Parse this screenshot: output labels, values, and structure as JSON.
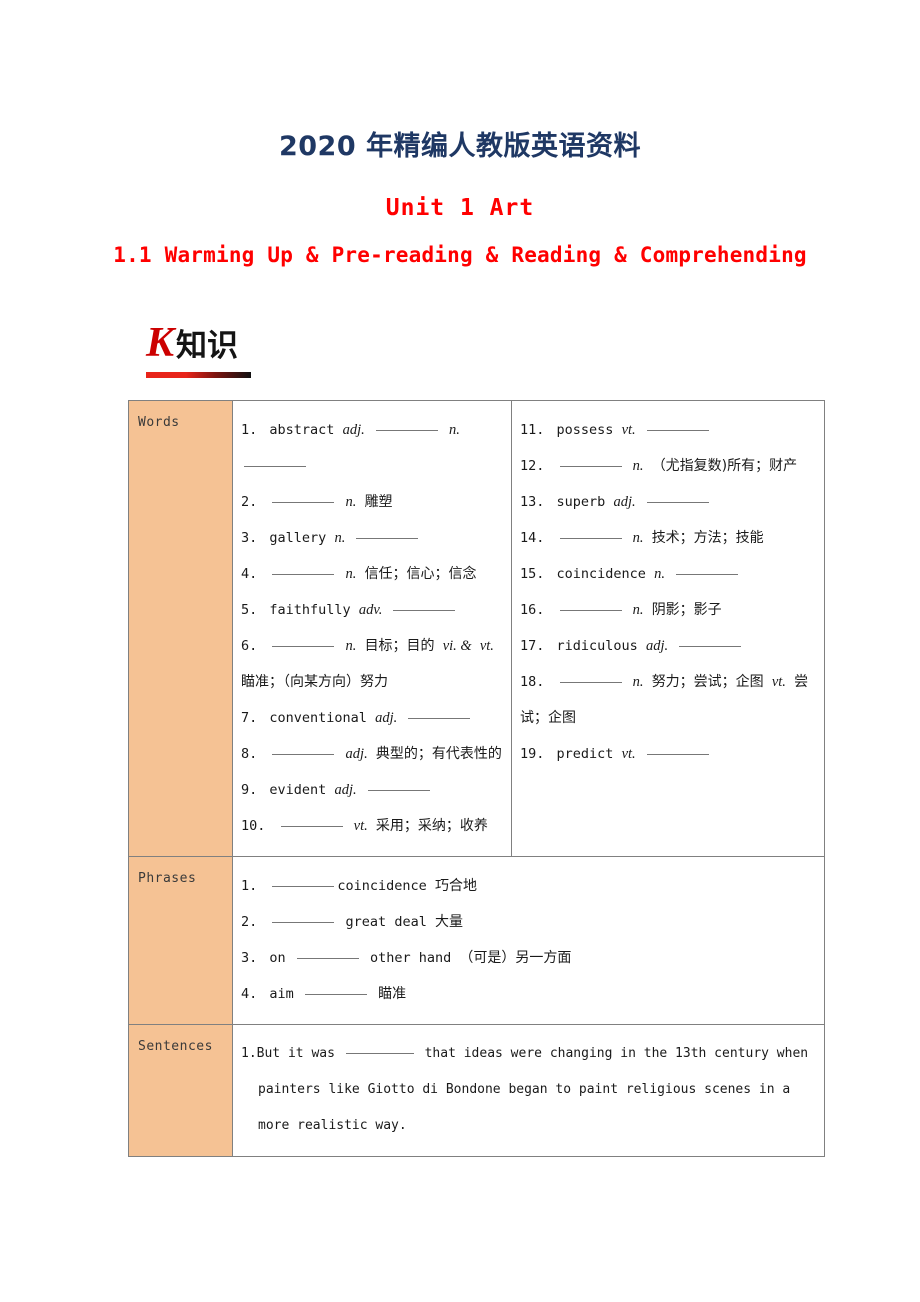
{
  "header": {
    "doc_title": "2020 年精编人教版英语资料",
    "unit_title": "Unit 1  Art",
    "sub_title": "1.1  Warming Up & Pre-reading & Reading & Comprehending"
  },
  "logo": {
    "letter": "K",
    "cn_text": "知识",
    "letter_color": "#CC0000",
    "rule_from": "#E8241A",
    "rule_to": "#101010"
  },
  "table": {
    "header_bg": "#F5C294",
    "border_color": "#808080",
    "rows": {
      "words_label": "Words",
      "phrases_label": "Phrases",
      "sentences_label": "Sentences"
    }
  },
  "words_left": [
    {
      "num": "1.",
      "pre": "abstract",
      "pos1": "adj.",
      "blank1": true,
      "pos2": "n.",
      "blank2": true,
      "cn": ""
    },
    {
      "num": "2.",
      "pre": "",
      "pos1": "",
      "blank_lead": true,
      "pos2": "n.",
      "cn": "雕塑"
    },
    {
      "num": "3.",
      "pre": "gallery",
      "pos1": "n.",
      "blank1": true,
      "cn": ""
    },
    {
      "num": "4.",
      "pre": "",
      "blank_lead": true,
      "pos2": "n.",
      "cn": "信任；信心；信念"
    },
    {
      "num": "5.",
      "pre": "faithfully",
      "pos1": "adv.",
      "blank1": true,
      "cn": ""
    },
    {
      "num": "6.",
      "pre": "",
      "blank_lead": true,
      "pos2": "n.",
      "cn": "目标；目的",
      "pos3": "vi. &",
      "pos4": "vt.",
      "cn2": "瞄准；（向某方向）努力"
    },
    {
      "num": "7.",
      "pre": "conventional",
      "pos1": "adj.",
      "blank1": true,
      "cn": ""
    },
    {
      "num": "8.",
      "pre": "",
      "blank_lead": true,
      "pos2": "adj.",
      "cn": "典型的；有代表性的"
    },
    {
      "num": "9.",
      "pre": "evident",
      "pos1": "adj.",
      "blank1": true,
      "cn": ""
    },
    {
      "num": "10.",
      "pre": "",
      "blank_lead": true,
      "pos2": "vt.",
      "cn": "采用；采纳；收养"
    }
  ],
  "words_right": [
    {
      "num": "11.",
      "pre": "possess",
      "pos1": "vt.",
      "blank1": true,
      "cn": ""
    },
    {
      "num": "12.",
      "pre": "",
      "blank_lead": true,
      "pos2": "n.",
      "cn": "（尤指复数)所有；财产"
    },
    {
      "num": "13.",
      "pre": "superb",
      "pos1": "adj.",
      "blank1": true,
      "cn": ""
    },
    {
      "num": "14.",
      "pre": "",
      "blank_lead": true,
      "pos2": "n.",
      "cn": "技术；方法；技能"
    },
    {
      "num": "15.",
      "pre": "coincidence",
      "pos1": "n.",
      "blank1": true,
      "cn": ""
    },
    {
      "num": "16.",
      "pre": "",
      "blank_lead": true,
      "pos2": "n.",
      "cn": "阴影；影子"
    },
    {
      "num": "17.",
      "pre": "ridiculous",
      "pos1": "adj.",
      "blank1": true,
      "cn": ""
    },
    {
      "num": "18.",
      "pre": "",
      "blank_lead": true,
      "pos2": "n.",
      "cn": "努力；尝试；企图",
      "pos4": "vt.",
      "cn2": "尝试；企图"
    },
    {
      "num": "19.",
      "pre": "predict",
      "pos1": "vt.",
      "blank1": true,
      "cn": ""
    }
  ],
  "phrases": [
    {
      "num": "1.",
      "blank_lead": true,
      "tail": "coincidence",
      "cn": "巧合地"
    },
    {
      "num": "2.",
      "blank_lead": true,
      "tail": "great deal",
      "cn": "大量"
    },
    {
      "num": "3.",
      "pre": "on",
      "blank_mid": true,
      "tail": "other hand",
      "cn": "（可是）另一方面"
    },
    {
      "num": "4.",
      "pre": "aim",
      "blank_mid": true,
      "tail": "",
      "cn": "瞄准"
    }
  ],
  "sentences": [
    {
      "num": "1.",
      "part1": "But it was",
      "part2": "that ideas were changing in the 13th century when",
      "line2": "painters like Giotto di Bondone began to paint religious scenes in a",
      "line3": "more realistic way."
    }
  ]
}
